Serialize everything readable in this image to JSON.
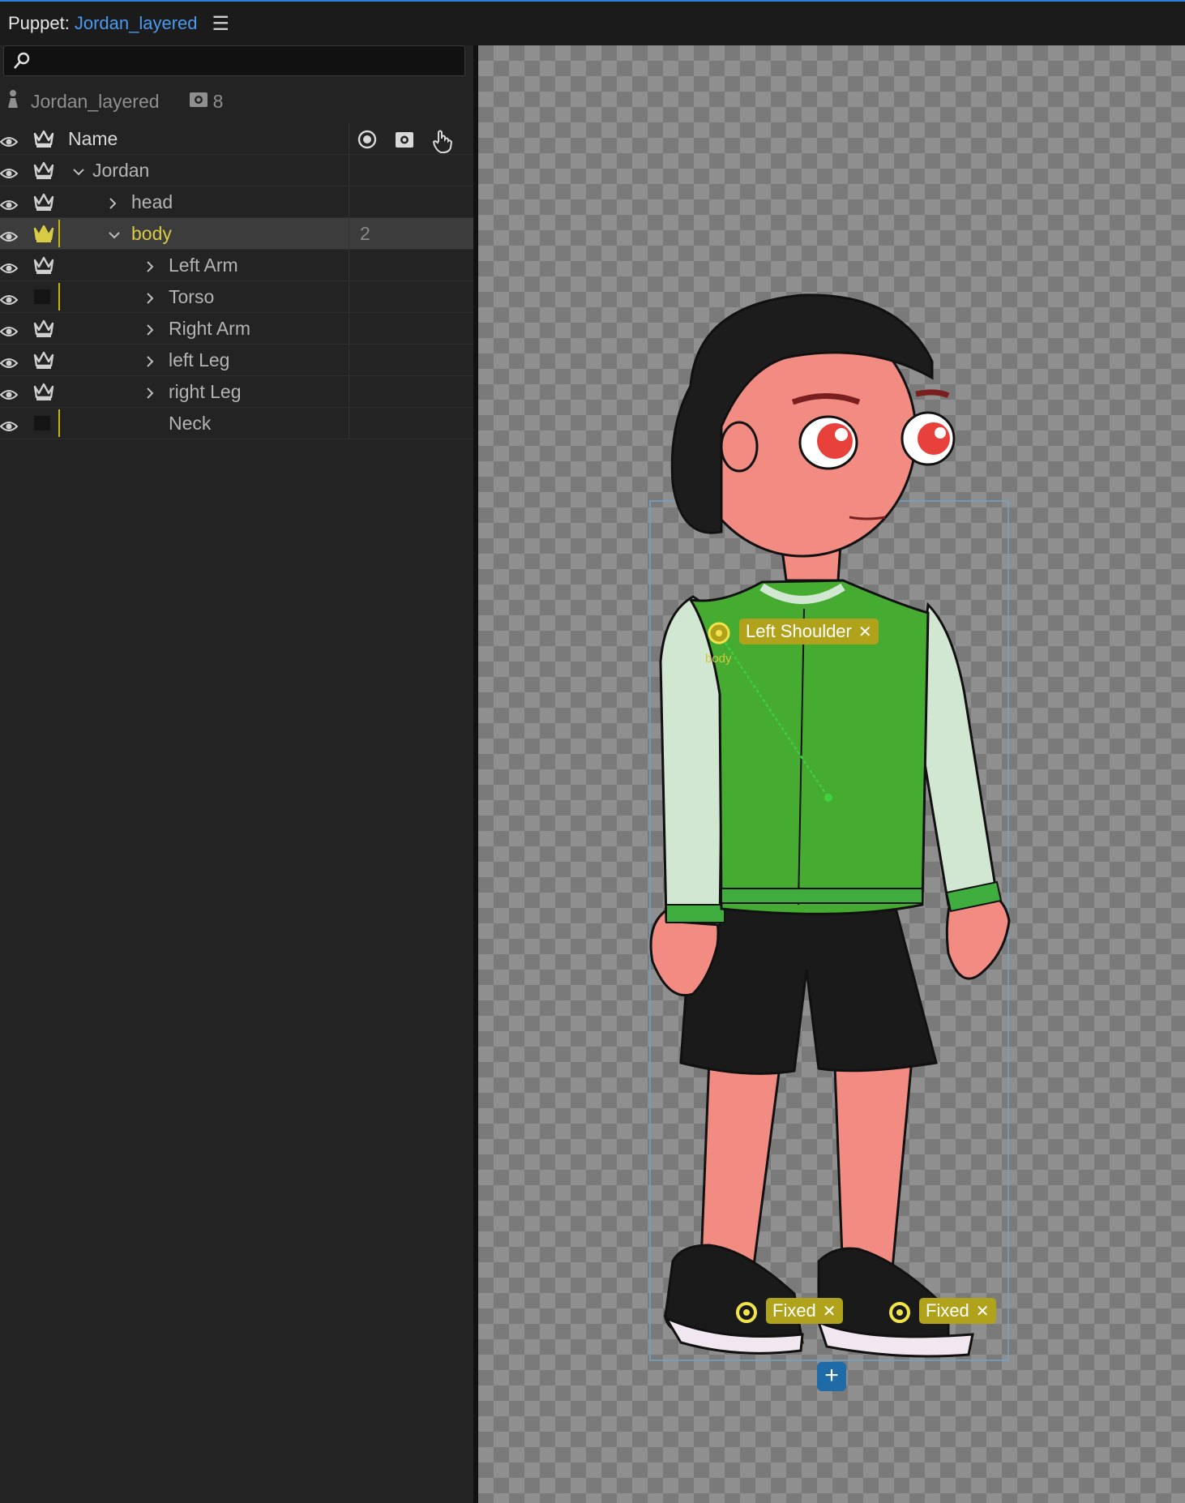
{
  "header": {
    "label": "Puppet:",
    "puppet_name": "Jordan_layered",
    "menu_icon": "hamburger-menu-icon"
  },
  "search": {
    "placeholder": "",
    "value": ""
  },
  "puppet_info": {
    "name": "Jordan_layered",
    "behavior_count": "8"
  },
  "table": {
    "header": {
      "name": "Name"
    },
    "rows": [
      {
        "name": "Jordan",
        "expanded": true,
        "level": 0,
        "count": ""
      },
      {
        "name": "head",
        "expanded": false,
        "level": 1,
        "count": ""
      },
      {
        "name": "body",
        "expanded": true,
        "level": 1,
        "count": "2",
        "selected": true
      },
      {
        "name": "Left Arm",
        "expanded": false,
        "level": 2,
        "count": ""
      },
      {
        "name": "Torso",
        "expanded": false,
        "level": 2,
        "count": ""
      },
      {
        "name": "Right Arm",
        "expanded": false,
        "level": 2,
        "count": ""
      },
      {
        "name": "left Leg",
        "expanded": false,
        "level": 2,
        "count": ""
      },
      {
        "name": "right Leg",
        "expanded": false,
        "level": 2,
        "count": ""
      },
      {
        "name": "Neck",
        "level": 2,
        "count": ""
      }
    ]
  },
  "canvas": {
    "handles": [
      {
        "label": "Left Shoulder",
        "close": "✕"
      },
      {
        "label": "Fixed",
        "close": "✕"
      },
      {
        "label": "Fixed",
        "close": "✕"
      }
    ],
    "origin_label": "body",
    "add_label": "+"
  },
  "colors": {
    "accent": "#2f7fe0",
    "handle": "#b1a21c",
    "selection": "#d8cc44"
  }
}
